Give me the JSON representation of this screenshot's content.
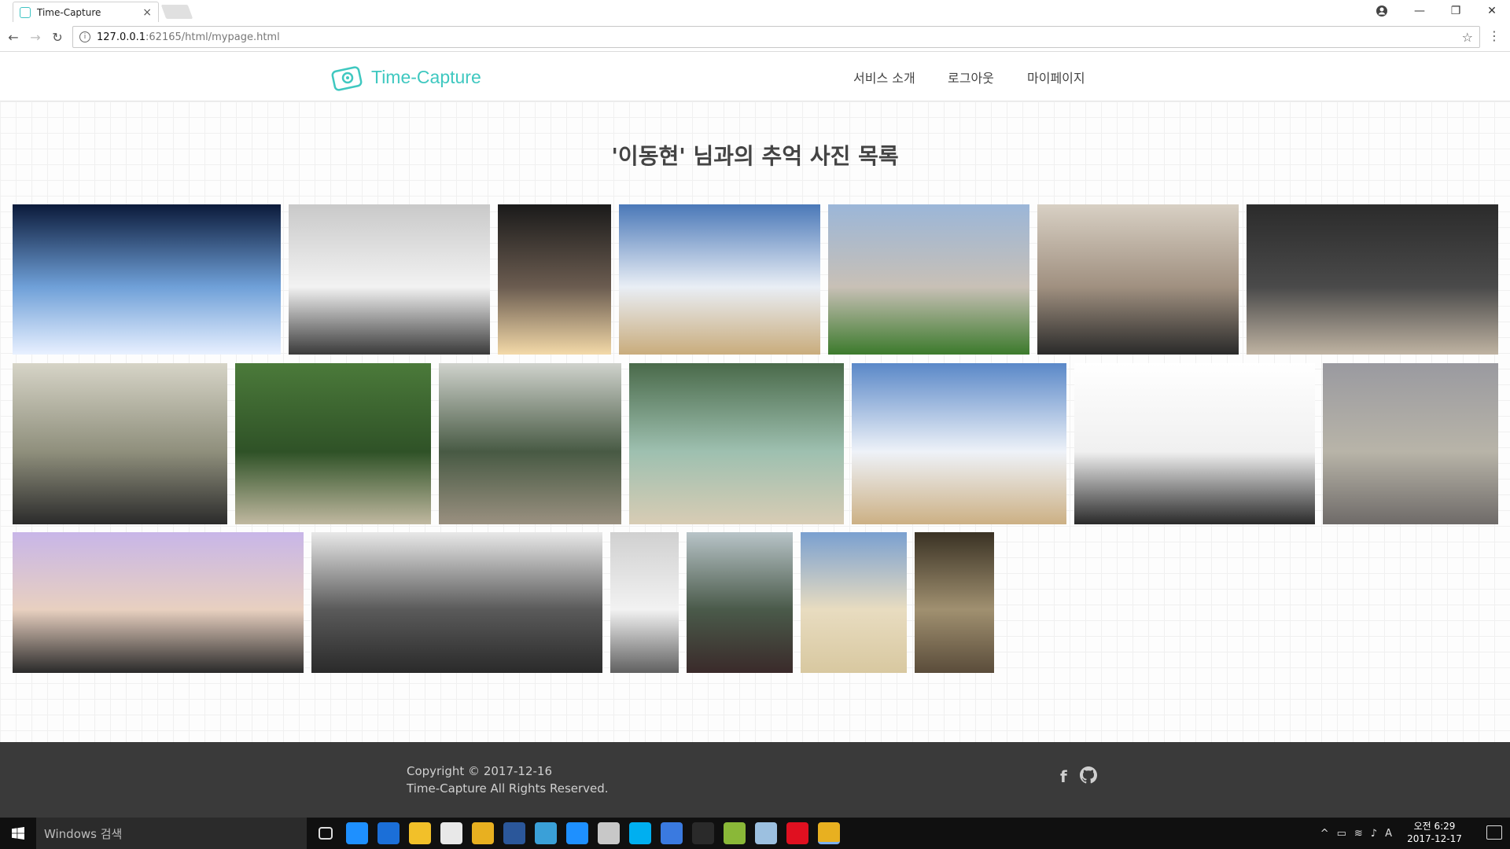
{
  "browser": {
    "tab_title": "Time-Capture",
    "tab_close": "×",
    "url_host": "127.0.0.1",
    "url_rest": ":62165/html/mypage.html",
    "controls": {
      "minimize": "—",
      "maximize": "❐",
      "close": "✕"
    }
  },
  "site": {
    "logo_text": "Time-Capture",
    "nav": [
      "서비스 소개",
      "로그아웃",
      "마이페이지"
    ],
    "accent_color": "#3fc8c0"
  },
  "page": {
    "title": "'이동현' 님과의 추억 사진 목록",
    "photos": [
      {
        "name": "castle-night-lights",
        "colors": [
          "#0b1a3a",
          "#6fa0d8",
          "#e8f0ff"
        ]
      },
      {
        "name": "classroom-group",
        "colors": [
          "#c9c9c9",
          "#f2f2f2",
          "#3a3a3a"
        ]
      },
      {
        "name": "sparkler-night",
        "colors": [
          "#1a1a1a",
          "#6b5c50",
          "#f3d9a8"
        ]
      },
      {
        "name": "beach-group",
        "colors": [
          "#4a78b8",
          "#e9eef5",
          "#c9ac7c"
        ]
      },
      {
        "name": "park-jump",
        "colors": [
          "#9bb6d8",
          "#c8c0b6",
          "#3c7a2c"
        ]
      },
      {
        "name": "mall-group",
        "colors": [
          "#d8d0c4",
          "#a09080",
          "#2a2a2a"
        ]
      },
      {
        "name": "cafe-drinks",
        "colors": [
          "#2b2b2b",
          "#4a4a4a",
          "#bfb3a2"
        ]
      },
      {
        "name": "greenhouse-dome",
        "colors": [
          "#d6d4c7",
          "#8f8f7c",
          "#2b2b2b"
        ]
      },
      {
        "name": "garden-wall",
        "colors": [
          "#4b7a3a",
          "#2f5227",
          "#c0b8a0"
        ]
      },
      {
        "name": "garden-dragonfly",
        "colors": [
          "#cfd2cc",
          "#485a44",
          "#9a9080"
        ]
      },
      {
        "name": "waterfall-garden",
        "colors": [
          "#4a6a4a",
          "#9ec0b0",
          "#d8ccb4"
        ]
      },
      {
        "name": "beach-group-2",
        "colors": [
          "#5a88c8",
          "#eef2f8",
          "#ccb084"
        ]
      },
      {
        "name": "uniform-group",
        "colors": [
          "#ffffff",
          "#f0f0f0",
          "#2a2a2a"
        ]
      },
      {
        "name": "selfie-faded",
        "colors": [
          "#9a9aa0",
          "#b8b4a8",
          "#6e6a68"
        ]
      },
      {
        "name": "selfie-close",
        "colors": [
          "#c8b6e8",
          "#e8d0c0",
          "#2a2a2a"
        ]
      },
      {
        "name": "conference-hall",
        "colors": [
          "#e8e8e8",
          "#5a5a5a",
          "#2a2a2a"
        ]
      },
      {
        "name": "office-room",
        "colors": [
          "#d0d0d0",
          "#f2f2f2",
          "#606060"
        ]
      },
      {
        "name": "mountain-path",
        "colors": [
          "#b8c4c8",
          "#4a5a4a",
          "#3a2a2a"
        ]
      },
      {
        "name": "beach-sand",
        "colors": [
          "#7aa0d0",
          "#e8dcc0",
          "#d8c8a0"
        ]
      },
      {
        "name": "audience-hall",
        "colors": [
          "#3a3224",
          "#a09070",
          "#5a4c3a"
        ]
      }
    ]
  },
  "footer": {
    "copyright": "Copyright © 2017-12-16",
    "rights": "Time-Capture All Rights Reserved.",
    "social": [
      "f",
      "github"
    ]
  },
  "taskbar": {
    "search_placeholder": "Windows 검색",
    "time": "오전 6:29",
    "date": "2017-12-17",
    "ime": "A",
    "apps": [
      {
        "name": "task-view-icon",
        "color": "#101010"
      },
      {
        "name": "ie-icon",
        "color": "#1e90ff"
      },
      {
        "name": "edge-icon",
        "color": "#1b6fd8"
      },
      {
        "name": "file-explorer-icon",
        "color": "#f2c029"
      },
      {
        "name": "store-icon",
        "color": "#e8e8e8"
      },
      {
        "name": "chrome-icon",
        "color": "#e8b020"
      },
      {
        "name": "word-icon",
        "color": "#2b579a"
      },
      {
        "name": "notepad-icon",
        "color": "#3aa0d8"
      },
      {
        "name": "vscode-icon",
        "color": "#1e90ff"
      },
      {
        "name": "paint-icon",
        "color": "#c8c8c8"
      },
      {
        "name": "skype-icon",
        "color": "#00aff0"
      },
      {
        "name": "files-icon",
        "color": "#3a7ae0"
      },
      {
        "name": "nox-icon",
        "color": "#2a2a2a"
      },
      {
        "name": "android-icon",
        "color": "#8ab838"
      },
      {
        "name": "app-icon",
        "color": "#9cc0e0"
      },
      {
        "name": "opera-icon",
        "color": "#e01020"
      },
      {
        "name": "chrome-active-icon",
        "color": "#e8b020"
      }
    ]
  }
}
